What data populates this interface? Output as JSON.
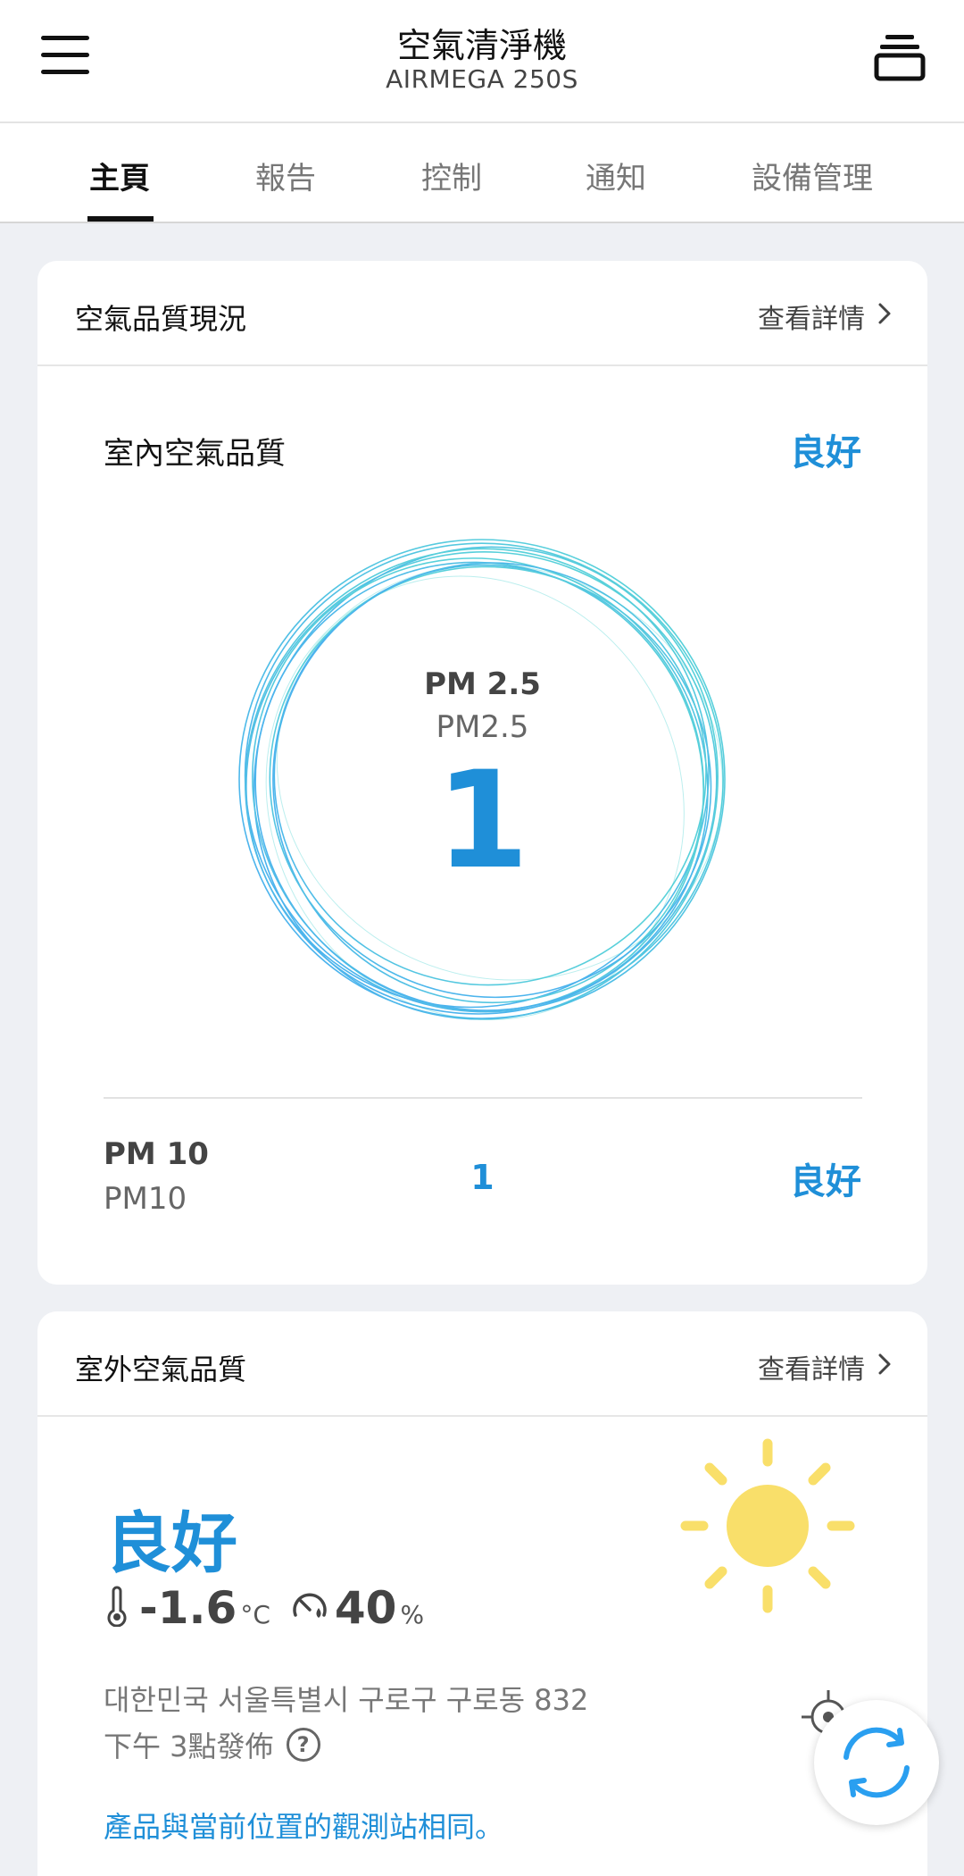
{
  "header": {
    "title": "空氣清淨機",
    "subtitle": "AIRMEGA 250S"
  },
  "tabs": [
    {
      "label": "主頁",
      "active": true
    },
    {
      "label": "報告",
      "active": false
    },
    {
      "label": "控制",
      "active": false
    },
    {
      "label": "通知",
      "active": false
    },
    {
      "label": "設備管理",
      "active": false
    }
  ],
  "air_quality_card": {
    "title": "空氣品質現況",
    "detail_link": "查看詳情",
    "indoor_label": "室內空氣品質",
    "indoor_status": "良好",
    "pm25": {
      "title": "PM 2.5",
      "subtitle": "PM2.5",
      "value": "1"
    },
    "pm10": {
      "title": "PM 10",
      "subtitle": "PM10",
      "value": "1",
      "status": "良好"
    }
  },
  "outdoor_card": {
    "title": "室外空氣品質",
    "detail_link": "查看詳情",
    "status": "良好",
    "temperature": "-1.6",
    "temperature_unit": "°C",
    "humidity": "40",
    "humidity_unit": "%",
    "address": "대한민국 서울특별시 구로구 구로동 832",
    "published": "下午 3點發佈",
    "help_icon_text": "?",
    "note": "產品與當前位置的觀測站相同。"
  },
  "colors": {
    "accent": "#1f8fd8",
    "sun": "#f9df6a",
    "ring_teal": "#3fd0cf",
    "ring_blue": "#2a9ff0"
  },
  "icons": {
    "menu": "hamburger-menu-icon",
    "device": "device-stack-icon",
    "chevron": "chevron-right-icon",
    "thermometer": "thermometer-icon",
    "humidity": "humidity-gauge-icon",
    "help": "question-circle-icon",
    "weather": "sun-icon",
    "locate": "locate-icon",
    "refresh": "refresh-icon"
  }
}
